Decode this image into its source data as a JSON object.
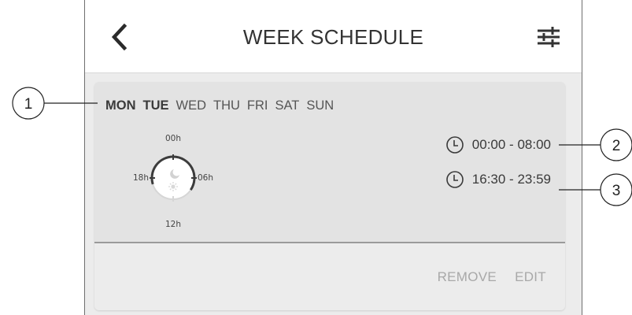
{
  "header": {
    "title": "WEEK SCHEDULE",
    "back_icon": "chevron-left-icon",
    "settings_icon": "sliders-icon"
  },
  "schedule_card": {
    "days": [
      {
        "label": "MON",
        "selected": true
      },
      {
        "label": "TUE",
        "selected": true
      },
      {
        "label": "WED",
        "selected": false
      },
      {
        "label": "THU",
        "selected": false
      },
      {
        "label": "FRI",
        "selected": false
      },
      {
        "label": "SAT",
        "selected": false
      },
      {
        "label": "SUN",
        "selected": false
      }
    ],
    "clock": {
      "top_label": "00h",
      "right_label": "06h",
      "bottom_label": "12h",
      "left_label": "18h"
    },
    "periods": [
      {
        "icon": "clock-icon",
        "time": "00:00 - 08:00"
      },
      {
        "icon": "clock-icon",
        "time": "16:30 - 23:59"
      }
    ],
    "actions": {
      "remove_label": "REMOVE",
      "edit_label": "EDIT"
    }
  },
  "callouts": [
    "1",
    "2",
    "3"
  ],
  "colors": {
    "card_background": "#e3e3e3",
    "divider": "#9a9a9a",
    "text": "#3a3a3a",
    "action_text": "#a8a8a8"
  }
}
